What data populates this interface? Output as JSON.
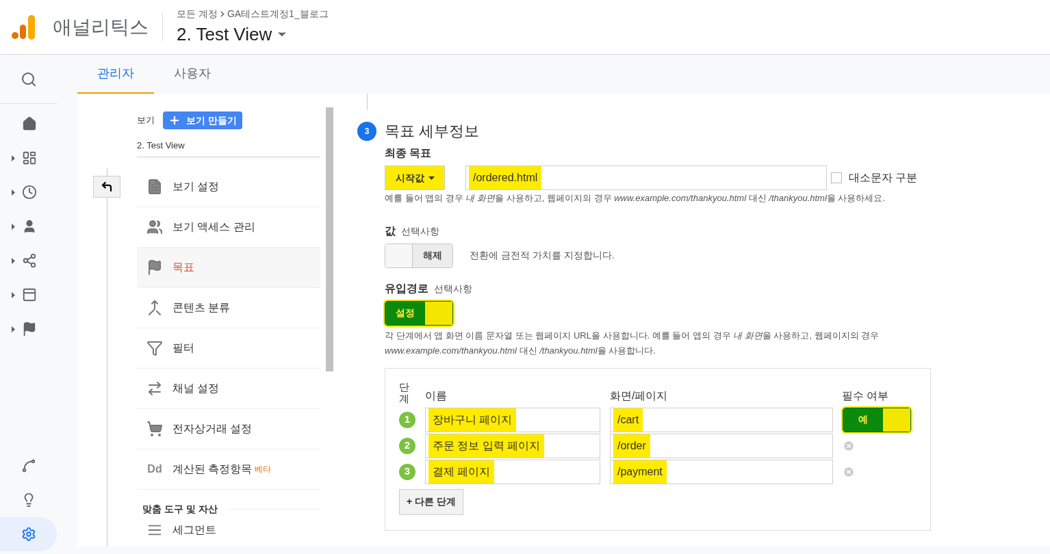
{
  "header": {
    "product": "애널리틱스",
    "breadcrumb": [
      "모든 계정",
      "GA테스트계정1_블로그"
    ],
    "view_title": "2. Test View"
  },
  "tabs": [
    {
      "label": "관리자",
      "selected": true
    },
    {
      "label": "사용자",
      "selected": false
    }
  ],
  "rail": [
    {
      "expandable": false,
      "selected": false
    },
    {
      "expandable": true,
      "selected": false
    },
    {
      "expandable": true,
      "selected": false
    },
    {
      "expandable": true,
      "selected": false
    },
    {
      "expandable": true,
      "selected": false
    },
    {
      "expandable": true,
      "selected": false
    },
    {
      "expandable": true,
      "selected": false
    }
  ],
  "rail_bottom": [
    {
      "selected": false
    },
    {
      "selected": false
    },
    {
      "selected": true
    }
  ],
  "admin_panel": {
    "column_label": "보기",
    "create_button": "보기 만들기",
    "view_name": "2. Test View",
    "items": [
      {
        "label": "보기 설정",
        "selected": false
      },
      {
        "label": "보기 액세스 관리",
        "selected": false
      },
      {
        "label": "목표",
        "selected": true
      },
      {
        "label": "콘텐츠 분류",
        "selected": false
      },
      {
        "label": "필터",
        "selected": false
      },
      {
        "label": "채널 설정",
        "selected": false
      },
      {
        "label": "전자상거래 설정",
        "selected": false
      },
      {
        "label": "계산된 측정항목",
        "selected": false,
        "badge": "베타",
        "icon_text": "Dd"
      }
    ],
    "section_title": "맞춤 도구 및 자산",
    "section_items": [
      {
        "label": "세그먼트"
      }
    ]
  },
  "goal_details": {
    "step_number": "3",
    "title": "목표 세부정보",
    "destination": {
      "label": "최종 목표",
      "match_type": "시작값",
      "match_highlighted": true,
      "value": "/ordered.html",
      "value_highlighted": true,
      "case_sensitive": {
        "label": "대소문자 구분",
        "checked": false
      },
      "help": [
        {
          "text": "예를 들어 앱의 경우 ",
          "italic": false
        },
        {
          "text": "내 화면",
          "italic": true
        },
        {
          "text": "을 사용하고, 웹페이지의 경우 ",
          "italic": false
        },
        {
          "text": "www.example.com/thankyou.html",
          "italic": true
        },
        {
          "text": " 대신 ",
          "italic": false
        },
        {
          "text": "/thankyou.html",
          "italic": true
        },
        {
          "text": "을 사용하세요.",
          "italic": false
        }
      ]
    },
    "value": {
      "label": "값",
      "optional": "선택사항",
      "toggle": {
        "label": "해제",
        "on": false,
        "highlighted": false
      },
      "description": "전환에 금전적 가치를 지정합니다."
    },
    "funnel": {
      "label": "유입경로",
      "optional": "선택사항",
      "toggle": {
        "label": "설정",
        "on": true,
        "highlighted": true
      },
      "help": [
        {
          "text": "각 단계에서 앱 화면 이름 문자열 또는 웹페이지 URL을 사용합니다. 예를 들어 앱의 경우 ",
          "italic": false
        },
        {
          "text": "내 화면",
          "italic": true
        },
        {
          "text": "을 사용하고, 웹페이지의 경우 ",
          "italic": false
        },
        {
          "text": "www.example.com/thankyou.html",
          "italic": true
        },
        {
          "text": " 대신 ",
          "italic": false
        },
        {
          "text": "/thankyou.html",
          "italic": true
        },
        {
          "text": "을 사용합니다.",
          "italic": false
        }
      ],
      "columns": [
        "단계",
        "이름",
        "화면/페이지",
        "필수 여부"
      ],
      "steps": [
        {
          "number": "1",
          "name": "장바구니 페이지",
          "page": "/cart",
          "highlighted": true,
          "required": {
            "label": "예",
            "on": true,
            "highlighted": true
          }
        },
        {
          "number": "2",
          "name": "주문 정보 입력 페이지",
          "page": "/order",
          "highlighted": true
        },
        {
          "number": "3",
          "name": "결제 페이지",
          "page": "/payment",
          "highlighted": true
        }
      ],
      "add_step": "+ 다른 단계"
    }
  }
}
